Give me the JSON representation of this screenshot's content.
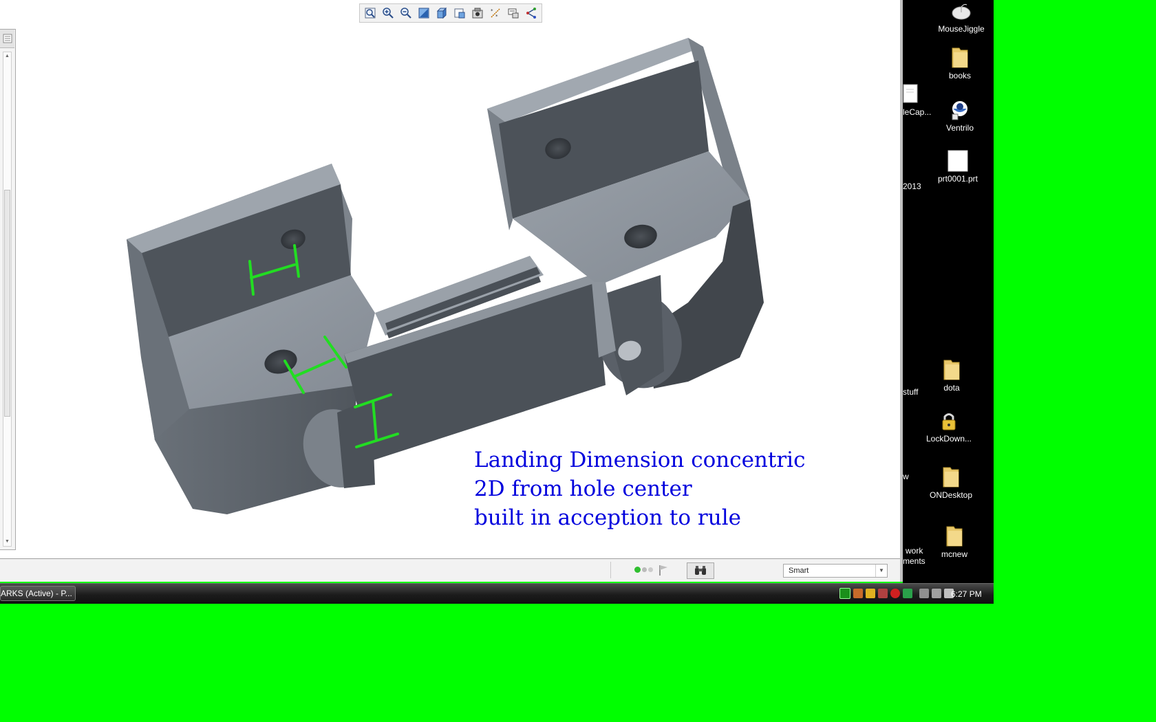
{
  "toolbar": {
    "buttons": [
      {
        "name": "refit-icon"
      },
      {
        "name": "zoom-in-icon"
      },
      {
        "name": "zoom-out-icon"
      },
      {
        "name": "repaint-icon"
      },
      {
        "name": "display-style-icon"
      },
      {
        "name": "saved-views-icon"
      },
      {
        "name": "view-manager-icon"
      },
      {
        "name": "datum-display-icon"
      },
      {
        "name": "annotation-display-icon"
      },
      {
        "name": "spin-center-icon"
      }
    ]
  },
  "annotation": {
    "lines": [
      "Landing Dimension concentric",
      "2D from hole center",
      "built in acception to rule"
    ],
    "color": "#0000dd"
  },
  "dimension_color": "#22dd22",
  "status_bar": {
    "filter_value": "Smart"
  },
  "desktop": {
    "icons": [
      {
        "label": "MouseJiggle",
        "icon": "mouse-icon"
      },
      {
        "label": "books",
        "icon": "folder-icon"
      },
      {
        "label": "Ventrilo",
        "icon": "ventrilo-icon"
      },
      {
        "label": "prt0001.prt",
        "icon": "document-icon"
      },
      {
        "label": "dota",
        "icon": "folder-icon"
      },
      {
        "label": "LockDown...",
        "icon": "lock-icon"
      },
      {
        "label": "ONDesktop",
        "icon": "folder-icon"
      },
      {
        "label": "mcnew",
        "icon": "folder-icon"
      }
    ],
    "partial_labels": [
      "leCap...",
      "2013",
      "stuff",
      "w",
      "work",
      "ments"
    ]
  },
  "taskbar": {
    "active_task": "ARKS (Active) - P...",
    "clock": "6:27 PM"
  },
  "colors": {
    "background_green": "#00ff00",
    "model_gray": "#8f969e",
    "model_dark": "#4a4f55"
  }
}
